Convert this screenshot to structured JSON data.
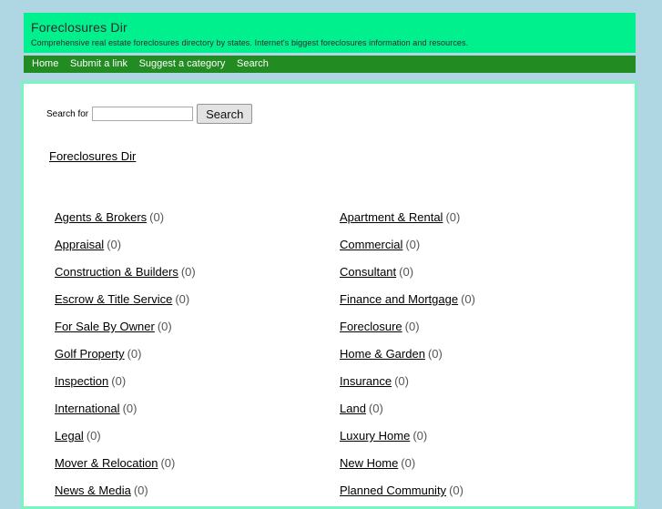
{
  "header": {
    "title": "Foreclosures Dir",
    "tagline": "Comprehensive real estate foreclosures directory by states. Internet's biggest foreclosures information and resources.",
    "bg_color": "#00f08d",
    "text_color": "#2b2b2b"
  },
  "nav": {
    "bg_color": "#228b22",
    "link_color": "#ffffff",
    "items": [
      {
        "label": "Home"
      },
      {
        "label": "Submit a link"
      },
      {
        "label": "Suggest a category"
      },
      {
        "label": "Search"
      }
    ]
  },
  "search": {
    "label": "Search for",
    "value": "",
    "placeholder": "",
    "button_label": "Search"
  },
  "breadcrumb": {
    "label": "Foreclosures Dir"
  },
  "page": {
    "background_color": "#aed7e3",
    "panel_background": "#ffffff",
    "panel_border_color": "#7af5c2"
  },
  "categories": {
    "left": [
      {
        "name": "Agents & Brokers",
        "count": "(0)"
      },
      {
        "name": "Appraisal",
        "count": "(0)"
      },
      {
        "name": "Construction & Builders",
        "count": "(0)"
      },
      {
        "name": "Escrow & Title Service",
        "count": "(0)"
      },
      {
        "name": "For Sale By Owner",
        "count": "(0)"
      },
      {
        "name": "Golf Property",
        "count": "(0)"
      },
      {
        "name": "Inspection",
        "count": "(0)"
      },
      {
        "name": "International",
        "count": "(0)"
      },
      {
        "name": "Legal",
        "count": "(0)"
      },
      {
        "name": "Mover & Relocation",
        "count": "(0)"
      },
      {
        "name": "News & Media",
        "count": "(0)"
      }
    ],
    "right": [
      {
        "name": "Apartment & Rental",
        "count": "(0)"
      },
      {
        "name": "Commercial",
        "count": "(0)"
      },
      {
        "name": "Consultant",
        "count": "(0)"
      },
      {
        "name": "Finance and Mortgage",
        "count": "(0)"
      },
      {
        "name": "Foreclosure",
        "count": "(0)"
      },
      {
        "name": "Home & Garden",
        "count": "(0)"
      },
      {
        "name": "Insurance",
        "count": "(0)"
      },
      {
        "name": "Land",
        "count": "(0)"
      },
      {
        "name": "Luxury Home",
        "count": "(0)"
      },
      {
        "name": "New Home",
        "count": "(0)"
      },
      {
        "name": "Planned Community",
        "count": "(0)"
      }
    ]
  }
}
